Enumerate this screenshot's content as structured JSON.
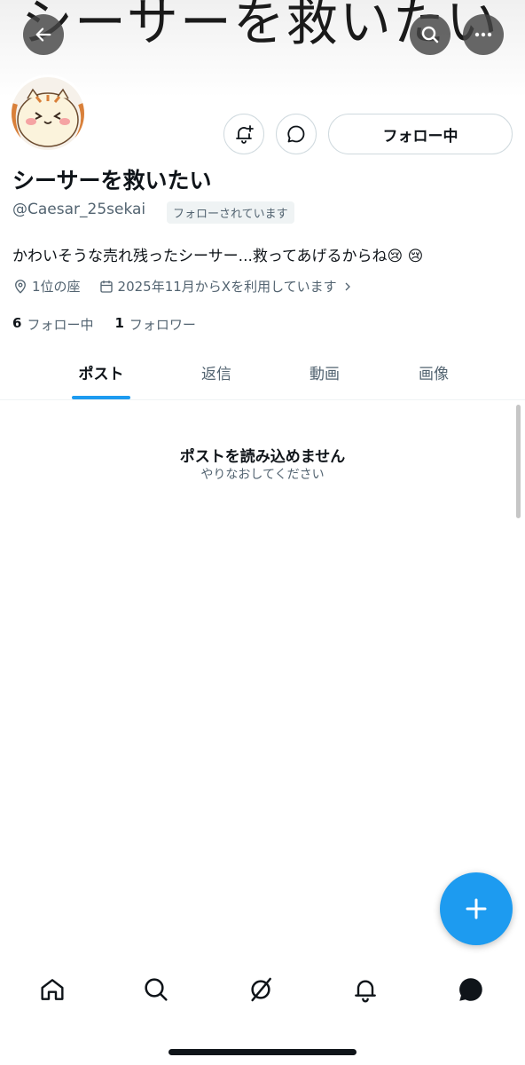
{
  "banner": {
    "text": "シーサーを救いたい"
  },
  "header": {
    "back_icon": "arrow-left-icon",
    "search_icon": "search-icon",
    "more_icon": "more-horizontal-icon"
  },
  "profile": {
    "display_name": "シーサーを救いたい",
    "handle": "@Caesar_25sekai",
    "follows_you": "フォローされています",
    "bio": "かわいそうな売れ残ったシーサー...救ってあげるからね😢 😢",
    "location": "1位の座",
    "joined": "2025年11月からXを利用しています",
    "following_count": "6",
    "following_label": "フォロー中",
    "followers_count": "1",
    "followers_label": "フォロワー"
  },
  "actions": {
    "follow_label": "フォロー中"
  },
  "tabs": [
    {
      "label": "ポスト",
      "active": true
    },
    {
      "label": "返信",
      "active": false
    },
    {
      "label": "動画",
      "active": false
    },
    {
      "label": "画像",
      "active": false
    }
  ],
  "empty_state": {
    "title": "ポストを読み込めません",
    "subtitle": "やりなおしてください"
  },
  "colors": {
    "accent": "#1d9bf0",
    "text": "#0f1419",
    "muted": "#536471",
    "border": "#cfd9de"
  }
}
